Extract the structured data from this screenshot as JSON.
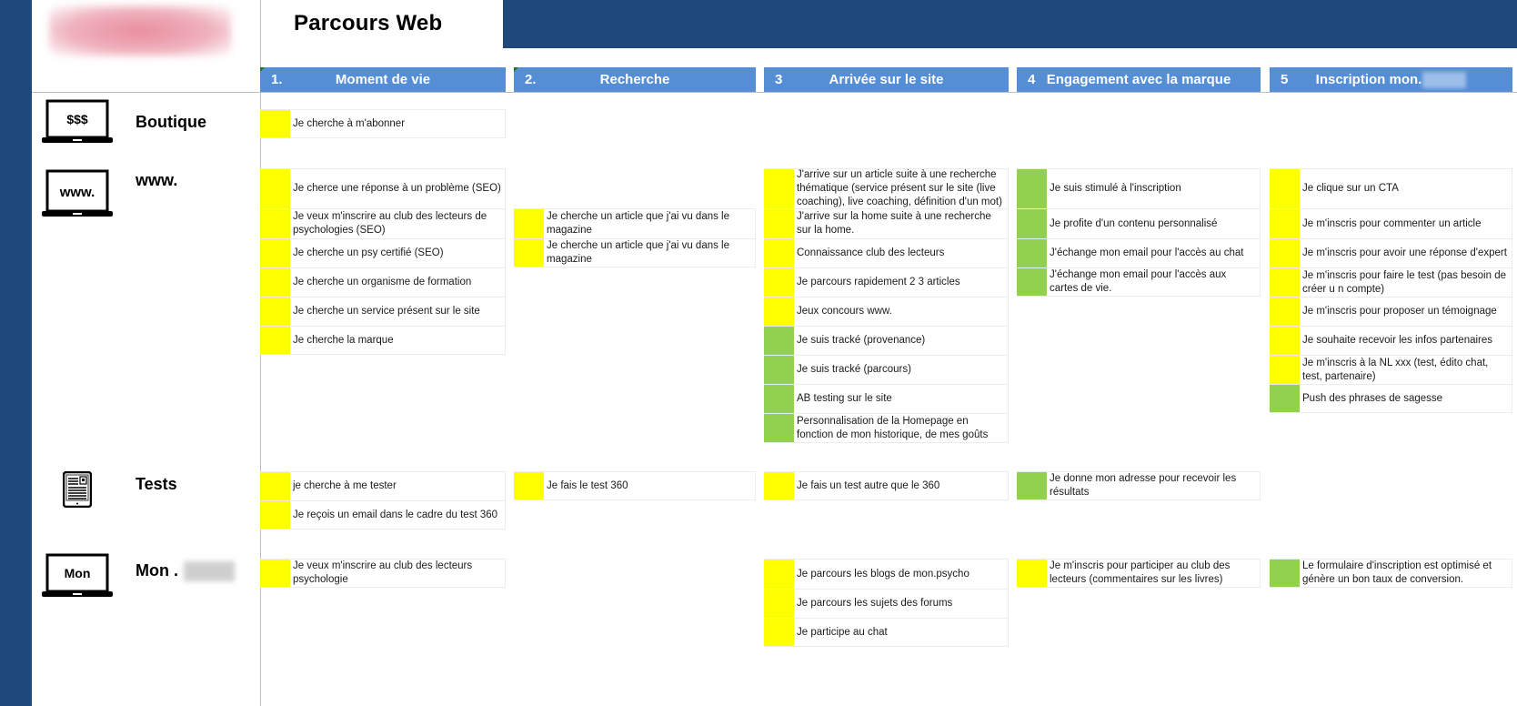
{
  "title": "Parcours Web",
  "colors": {
    "navy": "#1F497D",
    "header_blue": "#558ED5",
    "yellow": "#FFFF00",
    "green": "#92D050"
  },
  "columns": [
    {
      "num": "1.",
      "label": "Moment de vie"
    },
    {
      "num": "2.",
      "label": "Recherche"
    },
    {
      "num": "3",
      "label": "Arrivée sur le site"
    },
    {
      "num": "4",
      "label": "Engagement avec la marque"
    },
    {
      "num": "5",
      "label": "Inscription mon."
    }
  ],
  "rows": [
    {
      "label": "Boutique",
      "icon": "laptop-dollar-icon",
      "icon_text": "$$$"
    },
    {
      "label": "www.",
      "icon": "laptop-www-icon",
      "icon_text": "www."
    },
    {
      "label": "Tests",
      "icon": "tablet-document-icon",
      "icon_text": ""
    },
    {
      "label": "Mon .",
      "icon": "laptop-mon-icon",
      "icon_text": "Mon"
    }
  ],
  "cells": {
    "boutique": {
      "c1": [
        {
          "text": "Je cherche à m'abonner",
          "status": "yellow"
        }
      ]
    },
    "www": {
      "c1": [
        {
          "text": "Je cherce une réponse à un problème (SEO)",
          "status": "yellow"
        },
        {
          "text": "Je veux m'inscrire au club des lecteurs de psychologies (SEO)",
          "status": "yellow"
        },
        {
          "text": "Je cherche un psy certifié (SEO)",
          "status": "yellow"
        },
        {
          "text": "Je cherche un organisme de formation",
          "status": "yellow"
        },
        {
          "text": "Je cherche un service présent sur le site",
          "status": "yellow"
        },
        {
          "text": "Je cherche la marque",
          "status": "yellow"
        }
      ],
      "c2": [
        {
          "text": "Je cherche un article que j'ai vu dans le magazine",
          "status": "yellow"
        },
        {
          "text": "Je cherche un article que j'ai vu dans le magazine",
          "status": "yellow"
        }
      ],
      "c3": [
        {
          "text": "J'arrive sur un article suite à une recherche thématique (service présent sur le site (live coaching), live coaching, définition d'un mot)",
          "status": "yellow"
        },
        {
          "text": "J'arrive sur la home suite à une recherche sur la home.",
          "status": "yellow"
        },
        {
          "text": "Connaissance club des lecteurs",
          "status": "yellow"
        },
        {
          "text": "Je parcours rapidement 2 3 articles",
          "status": "yellow"
        },
        {
          "text": "Jeux concours www.",
          "status": "yellow"
        },
        {
          "text": "Je suis tracké (provenance)",
          "status": "green"
        },
        {
          "text": "Je suis tracké (parcours)",
          "status": "green"
        },
        {
          "text": "AB testing sur le site",
          "status": "green"
        },
        {
          "text": "Personnalisation de la Homepage en fonction de mon historique, de mes goûts",
          "status": "green"
        }
      ],
      "c4": [
        {
          "text": "Je suis stimulé à l'inscription",
          "status": "green"
        },
        {
          "text": "Je profite d'un contenu personnalisé",
          "status": "green"
        },
        {
          "text": "J'échange mon email pour l'accès au chat",
          "status": "green"
        },
        {
          "text": "J'échange mon email pour l'accès aux cartes de vie.",
          "status": "green"
        }
      ],
      "c5": [
        {
          "text": "Je clique sur un CTA",
          "status": "yellow"
        },
        {
          "text": "Je m'inscris pour commenter un article",
          "status": "yellow"
        },
        {
          "text": "Je m'inscris pour avoir une réponse d'expert",
          "status": "yellow"
        },
        {
          "text": "Je m'inscris pour faire le test (pas besoin de créer u n compte)",
          "status": "yellow"
        },
        {
          "text": "Je m'inscris pour proposer un témoignage",
          "status": "yellow"
        },
        {
          "text": "Je souhaite recevoir les infos partenaires",
          "status": "yellow"
        },
        {
          "text": "Je m'inscris à la NL xxx (test, édito chat, test, partenaire)",
          "status": "yellow"
        },
        {
          "text": "Push des phrases de sagesse",
          "status": "green"
        }
      ]
    },
    "tests": {
      "c1": [
        {
          "text": "je cherche à me tester",
          "status": "yellow"
        },
        {
          "text": "Je reçois un email dans le cadre du test 360",
          "status": "yellow"
        }
      ],
      "c2": [
        {
          "text": "Je fais le test 360",
          "status": "yellow"
        }
      ],
      "c3": [
        {
          "text": "Je fais un test autre que le 360",
          "status": "yellow"
        }
      ],
      "c4": [
        {
          "text": "Je donne mon adresse pour recevoir les résultats",
          "status": "green"
        }
      ]
    },
    "mon": {
      "c1": [
        {
          "text": "Je veux m'inscrire au club des lecteurs psychologie",
          "status": "yellow"
        }
      ],
      "c3": [
        {
          "text": "Je parcours les blogs de mon.psycho",
          "status": "yellow"
        },
        {
          "text": "Je parcours les sujets des forums",
          "status": "yellow"
        },
        {
          "text": "Je participe au chat",
          "status": "yellow"
        }
      ],
      "c4": [
        {
          "text": "Je m'inscris pour participer au club des lecteurs (commentaires sur les livres)",
          "status": "yellow"
        }
      ],
      "c5": [
        {
          "text": "Le formulaire d'inscription est optimisé et génère un bon taux de conversion.",
          "status": "green"
        }
      ]
    }
  }
}
